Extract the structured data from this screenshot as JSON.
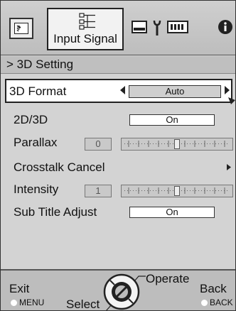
{
  "tabs": {
    "selected_label": "Input Signal",
    "items": [
      {
        "icon": "picture-icon"
      },
      {
        "icon": "input-signal-icon"
      },
      {
        "icon": "screen-icon"
      },
      {
        "icon": "wrench-icon"
      },
      {
        "icon": "network-icon"
      },
      {
        "icon": "info-icon"
      }
    ]
  },
  "section": {
    "arrow": ">",
    "title": "3D Setting"
  },
  "rows": {
    "format": {
      "label": "3D Format",
      "value": "Auto"
    },
    "mode": {
      "label": "2D/3D",
      "value": "On"
    },
    "parallax": {
      "label": "Parallax",
      "value": "0",
      "level": 0.5
    },
    "crosstalk": {
      "label": "Crosstalk Cancel"
    },
    "intensity": {
      "label": "Intensity",
      "value": "1",
      "level": 0.5
    },
    "subtitle": {
      "label": "Sub Title Adjust",
      "value": "On"
    }
  },
  "footer": {
    "exit_label": "Exit",
    "exit_key": "MENU",
    "select_label": "Select",
    "operate_label": "Operate",
    "back_label": "Back",
    "back_key": "BACK"
  },
  "colors": {
    "panel": "#d3d3d3",
    "tabbar": "#c4c4c4",
    "highlight": "#ffffff"
  }
}
